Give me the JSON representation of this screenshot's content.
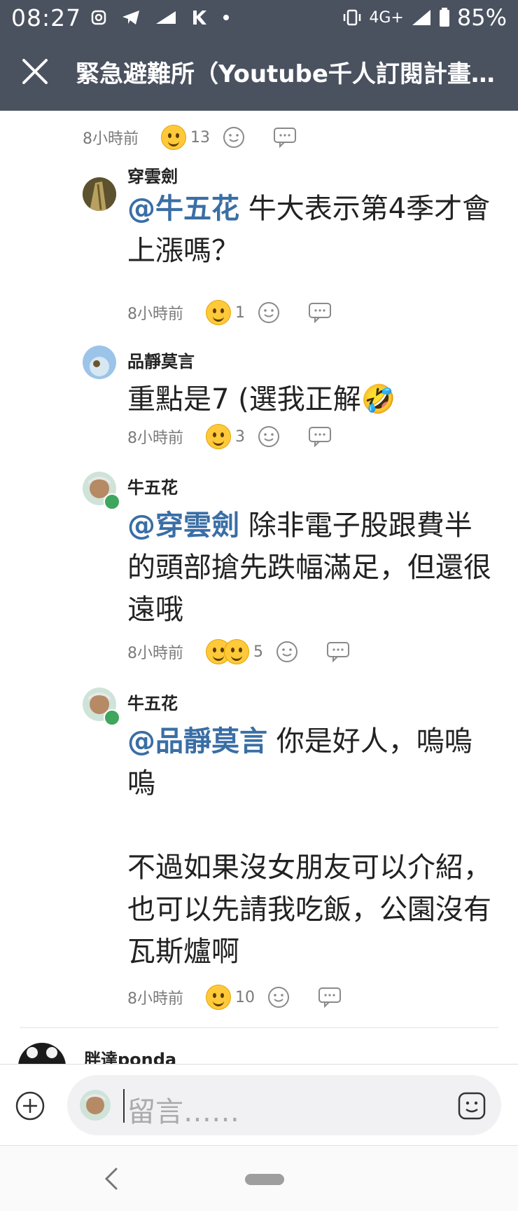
{
  "status_bar": {
    "time": "08:27",
    "network": "4G+",
    "battery": "85%",
    "icons": [
      "instagram-icon",
      "telegram-icon",
      "signal-icon",
      "k-icon",
      "dot-icon",
      "vibrate-icon",
      "cell-signal-icon",
      "battery-icon"
    ]
  },
  "header": {
    "close_icon": "close-icon",
    "title": "緊急避難所（Youtube千人訂閱計畫…"
  },
  "comments": [
    {
      "user": "",
      "mention": "",
      "text": "",
      "time": "8小時前",
      "reaction_count": "13"
    },
    {
      "user": "穿雲劍",
      "mention": "@牛五花",
      "text": " 牛大表示第4季才會上漲嗎？",
      "time": "8小時前",
      "reaction_count": "1"
    },
    {
      "user": "品靜莫言",
      "mention": "",
      "text": "重點是7 (選我正解🤣",
      "time": "8小時前",
      "reaction_count": "3"
    },
    {
      "user": "牛五花",
      "mention": "@穿雲劍",
      "text": " 除非電子股跟費半的頭部搶先跌幅滿足，但還很遠哦",
      "time": "8小時前",
      "reaction_count": "5"
    },
    {
      "user": "牛五花",
      "mention": "@品靜莫言",
      "text": " 你是好人，嗚嗚嗚",
      "text2": "不過如果沒女朋友可以介紹，也可以先請我吃飯，公園沒有瓦斯爐啊",
      "time": "8小時前",
      "reaction_count": "10"
    },
    {
      "user": "胖達ponda"
    }
  ],
  "composer": {
    "placeholder": "留言……",
    "plus_icon": "plus-circle-icon",
    "sticker_icon": "sticker-icon"
  },
  "nav": {
    "back_icon": "back-chevron-icon",
    "home_icon": "home-pill-icon"
  },
  "colors": {
    "header_bg": "#4a5260",
    "mention": "#3a6ea5",
    "badge": "#3ea65d"
  }
}
